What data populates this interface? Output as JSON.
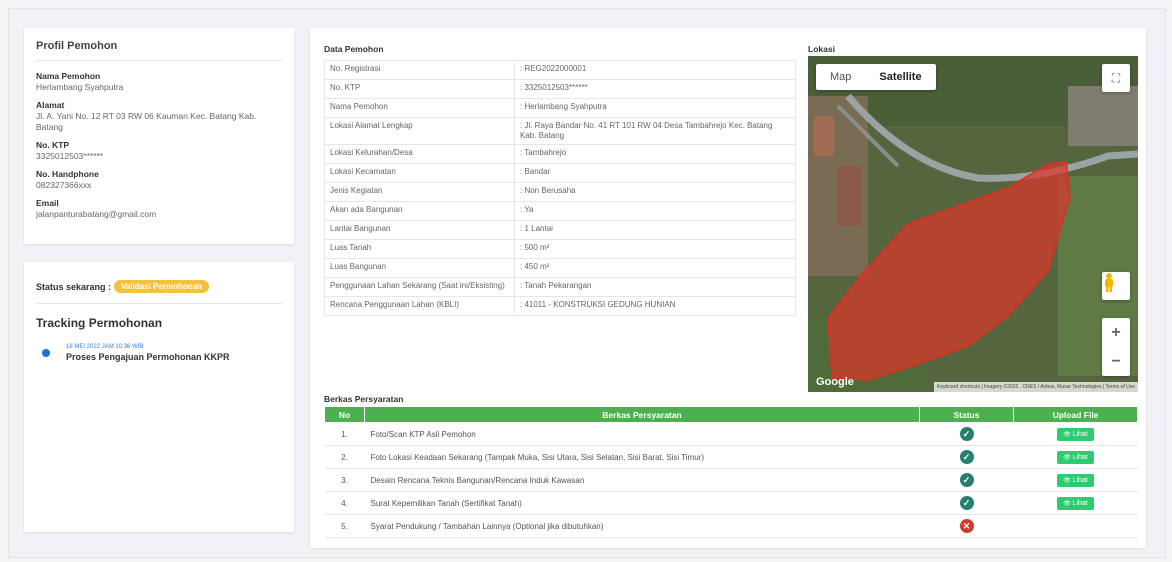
{
  "profile": {
    "title": "Profil Pemohon",
    "fields": [
      {
        "label": "Nama Pemohon",
        "value": "Herlambang Syahputra"
      },
      {
        "label": "Alamat",
        "value": "Jl. A. Yani No. 12 RT 03 RW 06 Kauman Kec. Batang Kab. Batang"
      },
      {
        "label": "No. KTP",
        "value": "3325012503******"
      },
      {
        "label": "No. Handphone",
        "value": "082327366xxx"
      },
      {
        "label": "Email",
        "value": "jalanpanturabatang@gmail.com"
      }
    ]
  },
  "status": {
    "label": "Status sekarang :",
    "badge": "Validasi Permohonan",
    "badge_color": "#f6c23e",
    "tracking_title": "Tracking Permohonan",
    "tracking": [
      {
        "time": "18 MEI 2022 JAM 10:36 WIB",
        "text": "Proses Pengajuan Permohonan KKPR"
      }
    ]
  },
  "data_pemohon": {
    "title": "Data Pemohon",
    "rows": [
      {
        "key": "No. Registrasi",
        "value": ": REG2022000001"
      },
      {
        "key": "No. KTP",
        "value": ": 3325012503******"
      },
      {
        "key": "Nama Pemohon",
        "value": ": Herlambang Syahputra"
      },
      {
        "key": "Lokasi Alamat Lengkap",
        "value": ": Jl. Raya Bandar No. 41 RT 101 RW 04 Desa Tambahrejo Kec. Batang Kab. Batang"
      },
      {
        "key": "Lokasi Kelurahan/Desa",
        "value": ": Tambahrejo"
      },
      {
        "key": "Lokasi Kecamatan",
        "value": ": Bandar"
      },
      {
        "key": "Jenis Kegiatan",
        "value": ": Non Berusaha"
      },
      {
        "key": "Akan ada Bangunan",
        "value": ": Ya"
      },
      {
        "key": "Lantai Bangunan",
        "value": ": 1 Lantai"
      },
      {
        "key": "Luas Tanah",
        "value": ": 500 m²"
      },
      {
        "key": "Luas Bangunan",
        "value": ": 450 m²"
      },
      {
        "key": "Penggunaan Lahan Sekarang (Saat ini/Eksisting)",
        "value": ": Tanah Pekarangan"
      },
      {
        "key": "Rencana Penggunaan Lahan (KBLI)",
        "value": ": 41011 - KONSTRUKSI GEDUNG HUNIAN"
      }
    ]
  },
  "map": {
    "title": "Lokasi",
    "tab_map": "Map",
    "tab_satellite": "Satellite",
    "zoom_in": "+",
    "zoom_out": "−",
    "google": "Google",
    "footer": "Keyboard shortcuts | Imagery ©2022 , CNES / Airbus, Maxar Technologies | Terms of Use",
    "polygon_color": "#d9362b"
  },
  "berkas": {
    "title": "Berkas Persyaratan",
    "headers": [
      "No",
      "Berkas Persyaratan",
      "Status",
      "Upload File"
    ],
    "lihat_label": "Lihat",
    "rows": [
      {
        "no": "1.",
        "name": "Foto/Scan KTP Asli Pemohon",
        "status": "ok"
      },
      {
        "no": "2.",
        "name": "Foto Lokasi Keadaan Sekarang (Tampak Muka, Sisi Utara, Sisi Selatan, Sisi Barat, Sisi Timur)",
        "status": "ok"
      },
      {
        "no": "3.",
        "name": "Desain Rencana Teknis Bangunan/Rencana Induk Kawasan",
        "status": "ok"
      },
      {
        "no": "4.",
        "name": "Surat Kepemilikan Tanah (Sertifikat Tanah)",
        "status": "ok"
      },
      {
        "no": "5.",
        "name": "Syarat Pendukung / Tambahan Lainnya (Optional jika dibutuhkan)",
        "status": "missing"
      }
    ]
  }
}
